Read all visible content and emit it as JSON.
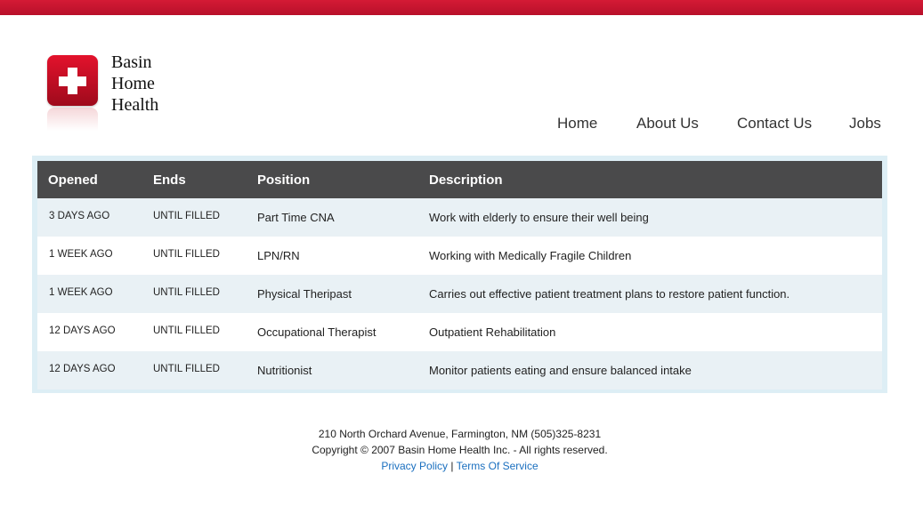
{
  "brand": {
    "name_lines": [
      "Basin",
      "Home",
      "Health"
    ],
    "logo_icon": "red-cross-icon",
    "top_bar_color": "#c8152f"
  },
  "nav": {
    "items": [
      "Home",
      "About Us",
      "Contact Us",
      "Jobs"
    ]
  },
  "jobs_table": {
    "headers": [
      "Opened",
      "Ends",
      "Position",
      "Description"
    ],
    "rows": [
      {
        "opened": "3 DAYS AGO",
        "ends": "UNTIL FILLED",
        "position": "Part Time CNA",
        "description": "Work with elderly to ensure their well being"
      },
      {
        "opened": "1 WEEK AGO",
        "ends": "UNTIL FILLED",
        "position": "LPN/RN",
        "description": "Working with Medically Fragile Children"
      },
      {
        "opened": "1 WEEK AGO",
        "ends": "UNTIL FILLED",
        "position": "Physical Theripast",
        "description": "Carries out effective patient treatment plans to restore patient function."
      },
      {
        "opened": "12 DAYS AGO",
        "ends": "UNTIL FILLED",
        "position": "Occupational Therapist",
        "description": "Outpatient Rehabilitation"
      },
      {
        "opened": "12 DAYS AGO",
        "ends": "UNTIL FILLED",
        "position": "Nutritionist",
        "description": "Monitor patients eating and ensure balanced intake"
      }
    ]
  },
  "footer": {
    "address": "210 North Orchard Avenue, Farmington, NM (505)325-8231",
    "copyright": "Copyright © 2007 Basin Home Health Inc. - All rights reserved.",
    "privacy_label": "Privacy Policy",
    "separator": "|",
    "terms_label": "Terms Of Service",
    "link_color": "#1a6fbf"
  }
}
